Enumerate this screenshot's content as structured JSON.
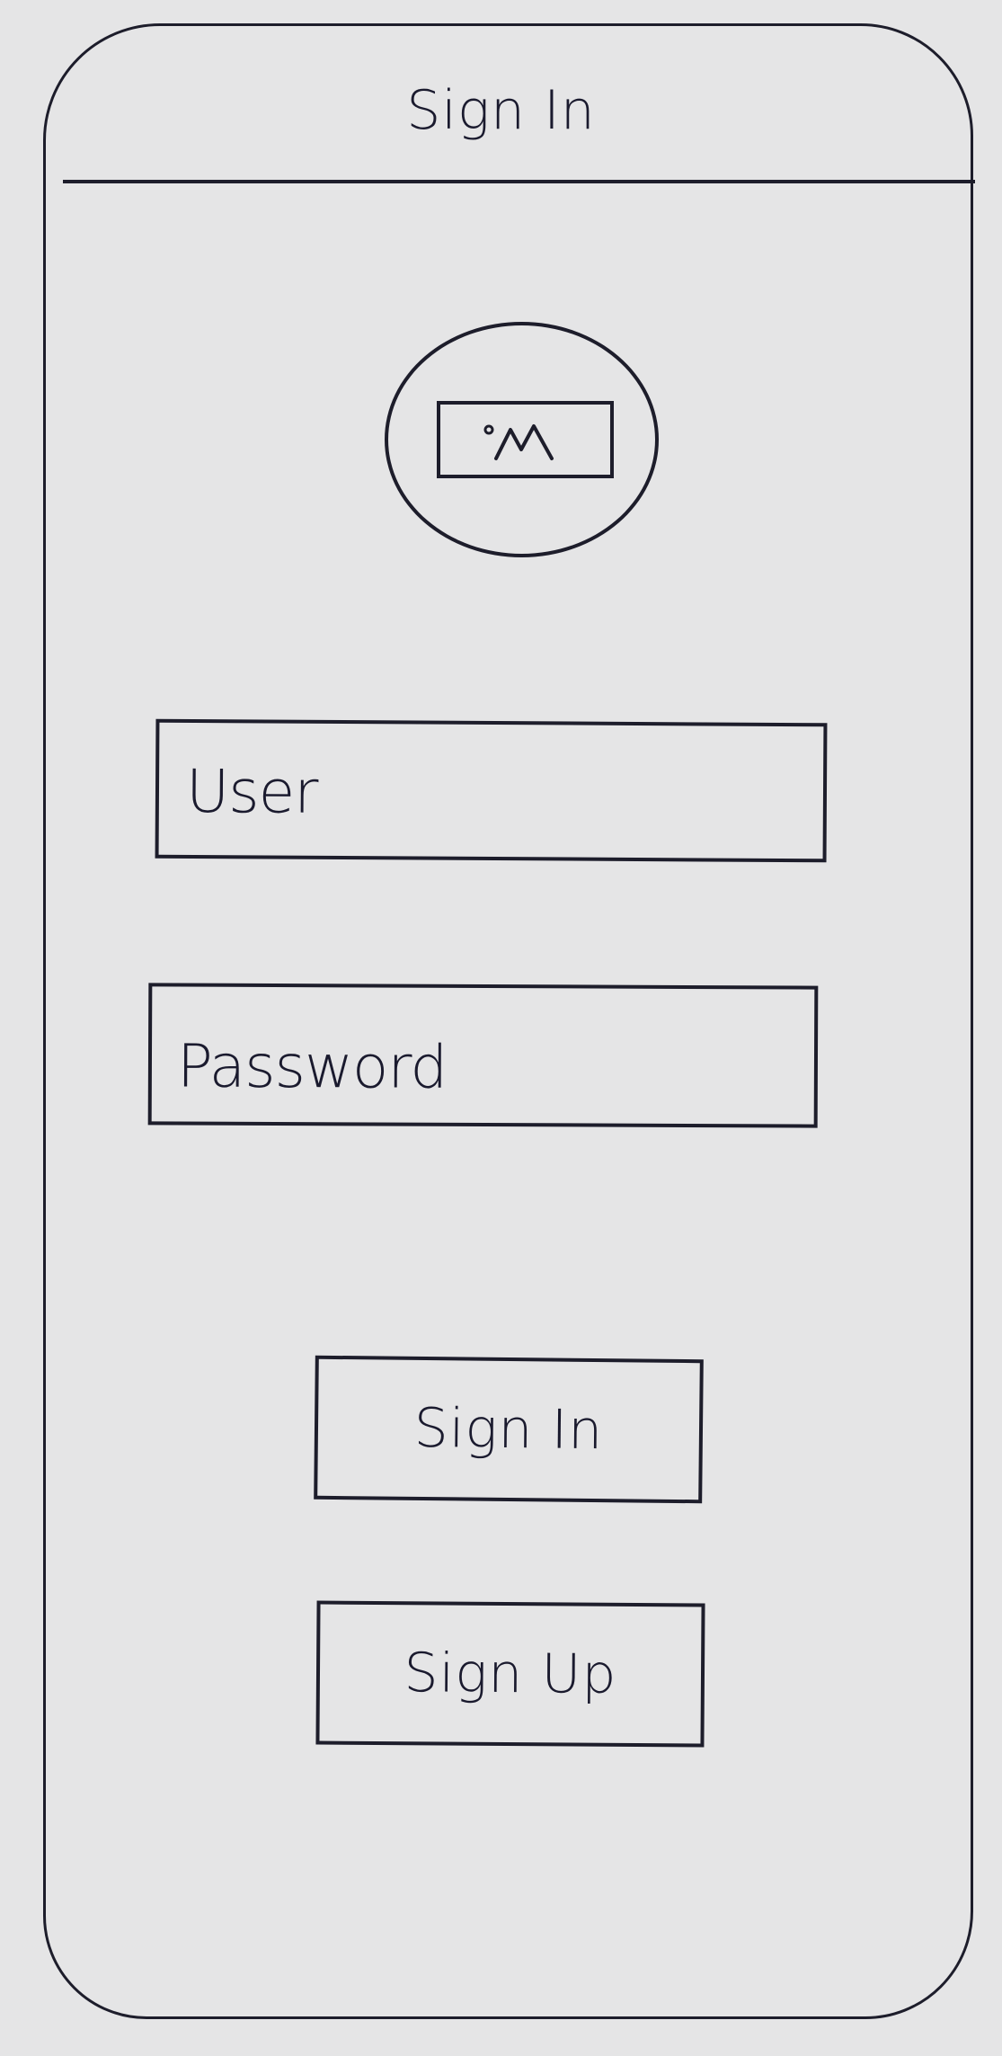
{
  "header": {
    "title": "Sign In"
  },
  "avatar": {
    "icon": "image-placeholder-icon"
  },
  "form": {
    "user_placeholder": "User",
    "password_placeholder": "Password"
  },
  "actions": {
    "sign_in_label": "Sign In",
    "sign_up_label": "Sign Up"
  },
  "colors": {
    "background": "#e5e5e6",
    "ink": "#1d1d2b"
  }
}
